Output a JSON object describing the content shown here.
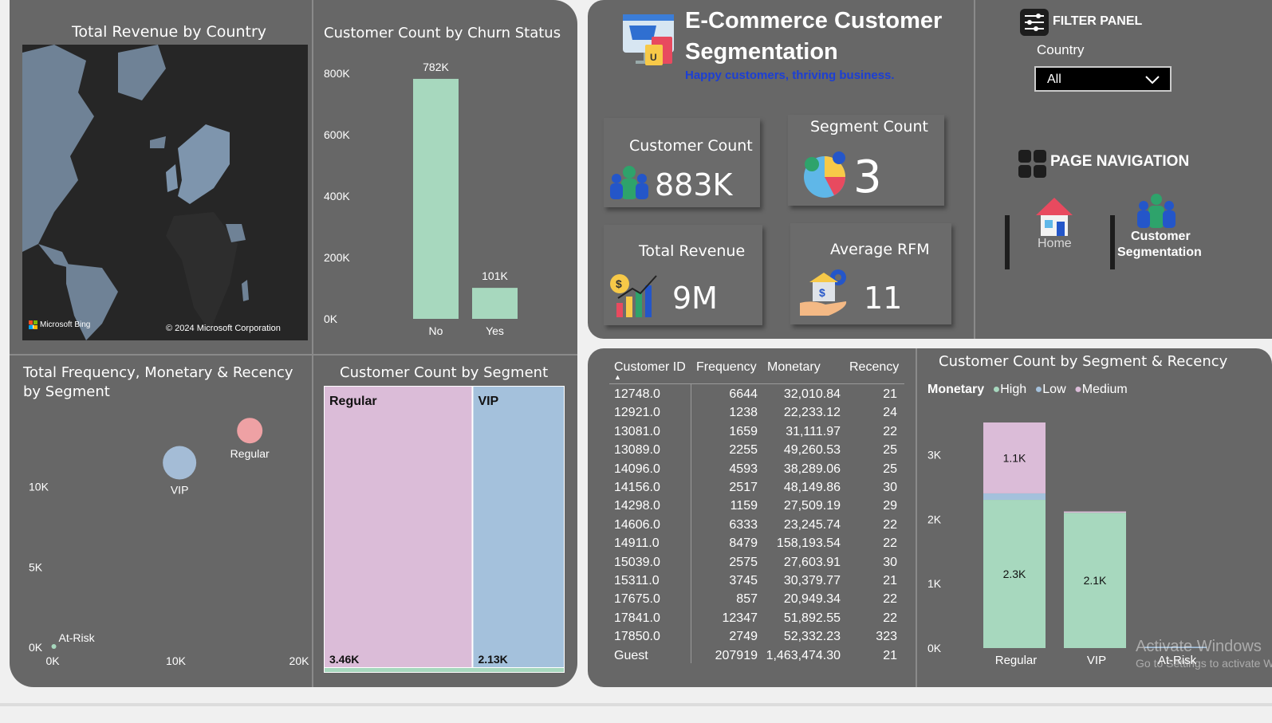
{
  "map_panel": {
    "title": "Total Revenue by Country",
    "bing_logo_text": "Microsoft Bing",
    "copyright": "© 2024 Microsoft Corporation"
  },
  "churn_chart": {
    "title": "Customer Count by Churn Status",
    "chart_data": {
      "type": "bar",
      "title": "Customer Count by Churn Status",
      "categories": [
        "No",
        "Yes"
      ],
      "values": [
        782000,
        101000
      ],
      "data_labels": [
        "782K",
        "101K"
      ],
      "yticks": [
        "0K",
        "200K",
        "400K",
        "600K",
        "800K"
      ],
      "ytick_values": [
        0,
        200000,
        400000,
        600000,
        800000
      ],
      "ylim": [
        0,
        800000
      ],
      "color": "#a7d8be"
    }
  },
  "scatter_chart": {
    "title_line1": "Total Frequency, Monetary & Recency",
    "title_line2": "by Segment",
    "chart_data": {
      "type": "scatter",
      "title": "Total Frequency, Monetary & Recency by Segment",
      "points": [
        {
          "label": "Regular",
          "x": 16000,
          "y": 13500,
          "color": "#eea1a4"
        },
        {
          "label": "VIP",
          "x": 10300,
          "y": 11500,
          "color": "#a4bcd6"
        },
        {
          "label": "At-Risk",
          "x": 100,
          "y": 50,
          "color": "#a7d8be"
        }
      ],
      "xticks": [
        "0K",
        "10K",
        "20K"
      ],
      "xtick_values": [
        0,
        10000,
        20000
      ],
      "yticks": [
        "0K",
        "5K",
        "10K"
      ],
      "ytick_values": [
        0,
        5000,
        10000
      ],
      "xlim": [
        0,
        20000
      ],
      "ylim": [
        0,
        15000
      ]
    }
  },
  "treemap_chart": {
    "title": "Customer Count by Segment",
    "chart_data": {
      "type": "bar",
      "title": "Customer Count by Segment",
      "categories": [
        "Regular",
        "VIP",
        "At-Risk"
      ],
      "values": [
        3460,
        2130,
        20
      ],
      "data_labels": [
        "3.46K",
        "2.13K",
        ""
      ],
      "colors": [
        "#dbbcd8",
        "#a4c1dc",
        "#a7d8be"
      ]
    }
  },
  "header": {
    "title_line1": "E-Commerce Customer",
    "title_line2": "Segmentation",
    "subtitle": "Happy customers, thriving business."
  },
  "kpis": {
    "customer_count": {
      "label": "Customer Count",
      "value": "883K"
    },
    "segment_count": {
      "label": "Segment Count",
      "value": "3"
    },
    "total_revenue": {
      "label": "Total Revenue",
      "value": "9M"
    },
    "average_rfm": {
      "label": "Average RFM",
      "value": "11"
    }
  },
  "filter_panel": {
    "heading": "FILTER PANEL",
    "country_label": "Country",
    "country_value": "All"
  },
  "navigation": {
    "heading": "PAGE NAVIGATION",
    "home_label": "Home",
    "seg_label_line1": "Customer",
    "seg_label_line2": "Segmentation"
  },
  "table": {
    "columns": [
      "Customer ID",
      "Frequency",
      "Monetary",
      "Recency"
    ],
    "rows": [
      [
        "12748.0",
        "6644",
        "32,010.84",
        "21"
      ],
      [
        "12921.0",
        "1238",
        "22,233.12",
        "24"
      ],
      [
        "13081.0",
        "1659",
        "31,111.97",
        "22"
      ],
      [
        "13089.0",
        "2255",
        "49,260.53",
        "25"
      ],
      [
        "14096.0",
        "4593",
        "38,289.06",
        "25"
      ],
      [
        "14156.0",
        "2517",
        "48,149.86",
        "30"
      ],
      [
        "14298.0",
        "1159",
        "27,509.19",
        "29"
      ],
      [
        "14606.0",
        "6333",
        "23,245.74",
        "22"
      ],
      [
        "14911.0",
        "8479",
        "158,193.54",
        "22"
      ],
      [
        "15039.0",
        "2575",
        "27,603.91",
        "30"
      ],
      [
        "15311.0",
        "3745",
        "30,379.77",
        "21"
      ],
      [
        "17675.0",
        "857",
        "20,949.34",
        "22"
      ],
      [
        "17841.0",
        "12347",
        "51,892.55",
        "22"
      ],
      [
        "17850.0",
        "2749",
        "52,332.23",
        "323"
      ],
      [
        "Guest",
        "207919",
        "1,463,474.30",
        "21"
      ]
    ]
  },
  "stacked_chart": {
    "title": "Customer Count by Segment & Recency",
    "legend_title": "Monetary",
    "chart_data": {
      "type": "bar",
      "title": "Customer Count by Segment & Recency",
      "categories": [
        "Regular",
        "VIP",
        "At-Risk"
      ],
      "series": [
        {
          "name": "High",
          "values": [
            2300,
            2100,
            0
          ],
          "color": "#a7d8be"
        },
        {
          "name": "Low",
          "values": [
            100,
            0,
            20
          ],
          "color": "#a4c1dc"
        },
        {
          "name": "Medium",
          "values": [
            1100,
            20,
            0
          ],
          "color": "#dbbcd8"
        }
      ],
      "data_labels": {
        "High": [
          "2.3K",
          "2.1K",
          ""
        ],
        "Medium": [
          "1.1K",
          "",
          ""
        ]
      },
      "yticks": [
        "0K",
        "1K",
        "2K",
        "3K"
      ],
      "ytick_values": [
        0,
        1000,
        2000,
        3000
      ],
      "ylim": [
        0,
        3500
      ],
      "legend_position": "top-left"
    }
  },
  "watermark": {
    "line1": "Activate Windows",
    "line2": "Go to Settings to activate Windows."
  }
}
